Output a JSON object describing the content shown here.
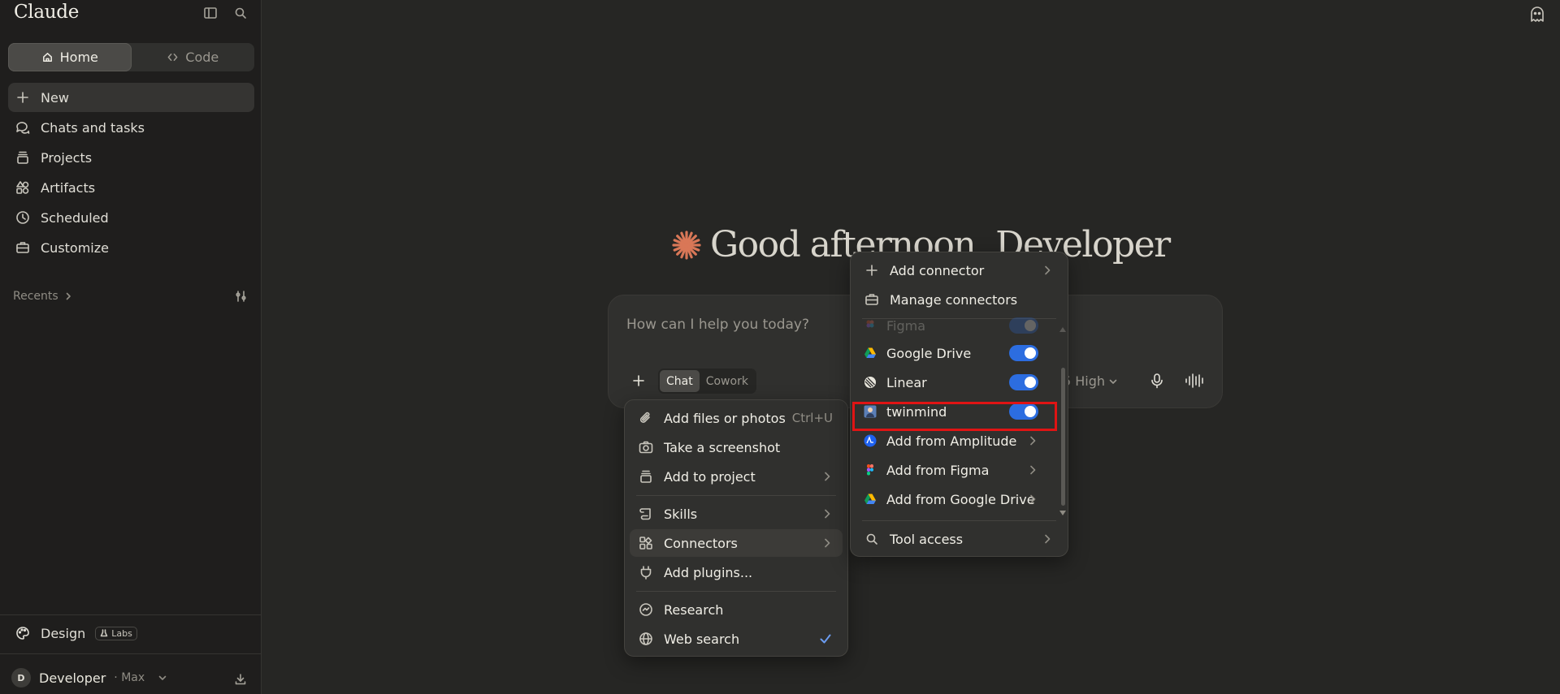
{
  "sidebar": {
    "brand": "Claude",
    "toggle_icon": "sidebar-toggle-icon",
    "search_icon": "search-icon",
    "segments": [
      {
        "label": "Home",
        "icon": "home-icon",
        "active": true
      },
      {
        "label": "Code",
        "icon": "code-icon",
        "active": false
      }
    ],
    "nav": [
      {
        "label": "New",
        "icon": "plus-icon"
      },
      {
        "label": "Chats and tasks",
        "icon": "chat-icon"
      },
      {
        "label": "Projects",
        "icon": "projects-icon"
      },
      {
        "label": "Artifacts",
        "icon": "artifacts-icon"
      },
      {
        "label": "Scheduled",
        "icon": "clock-icon"
      },
      {
        "label": "Customize",
        "icon": "briefcase-icon"
      }
    ],
    "recents_label": "Recents",
    "design_label": "Design",
    "labs_label": "Labs",
    "user": {
      "initial": "D",
      "name": "Developer",
      "plan": "· Max"
    }
  },
  "main": {
    "greeting": "Good afternoon, Developer",
    "composer": {
      "placeholder": "How can I help you today?",
      "modes": [
        "Chat",
        "Cowork"
      ],
      "active_mode": "Chat",
      "model_label": "5  High"
    }
  },
  "plus_menu": {
    "items": [
      {
        "label": "Add files or photos",
        "icon": "paperclip-icon",
        "shortcut": "Ctrl+U"
      },
      {
        "label": "Take a screenshot",
        "icon": "camera-icon"
      },
      {
        "label": "Add to project",
        "icon": "project-icon",
        "submenu": true
      },
      {
        "label": "Skills",
        "icon": "skills-icon",
        "submenu": true
      },
      {
        "label": "Connectors",
        "icon": "connectors-icon",
        "submenu": true,
        "highlighted": true
      },
      {
        "label": "Add plugins...",
        "icon": "plugin-icon"
      },
      {
        "label": "Research",
        "icon": "research-icon"
      },
      {
        "label": "Web search",
        "icon": "globe-icon",
        "checked": true
      }
    ]
  },
  "connectors_menu": {
    "add_connector": "Add connector",
    "manage_connectors": "Manage connectors",
    "items": [
      {
        "label": "Figma",
        "enabled": true,
        "faded": true
      },
      {
        "label": "Google Drive",
        "enabled": true
      },
      {
        "label": "Linear",
        "enabled": true
      },
      {
        "label": "twinmind",
        "enabled": true,
        "selected": true
      }
    ],
    "add_from": [
      "Add from Amplitude",
      "Add from Figma",
      "Add from Google Drive"
    ],
    "tool_access": "Tool access"
  },
  "colors": {
    "accent": "#d97757",
    "toggle_on": "#2c6de0",
    "highlight_box": "#e01414"
  }
}
